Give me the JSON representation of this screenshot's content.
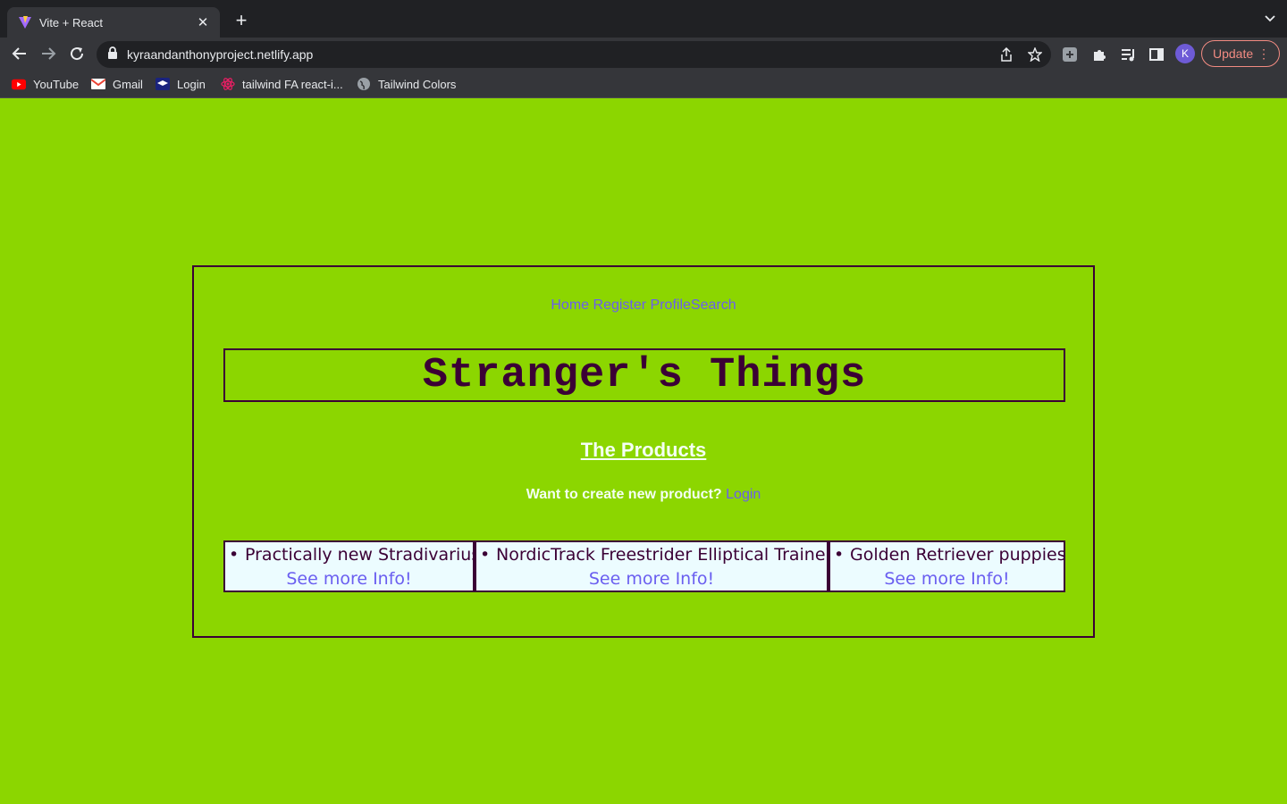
{
  "browser": {
    "tab_title": "Vite + React",
    "url": "kyraandanthonyproject.netlify.app",
    "avatar_letter": "K",
    "update_label": "Update",
    "bookmarks": [
      {
        "label": "YouTube",
        "icon": "youtube-icon"
      },
      {
        "label": "Gmail",
        "icon": "gmail-icon"
      },
      {
        "label": "Login",
        "icon": "graduation-cap-icon"
      },
      {
        "label": "tailwind FA react-i...",
        "icon": "react-icon"
      },
      {
        "label": "Tailwind Colors",
        "icon": "globe-icon"
      }
    ]
  },
  "site": {
    "nav": {
      "home": "Home",
      "register": "Register",
      "profile": "Profile",
      "search": "Search"
    },
    "title": "Stranger's Things",
    "products_heading": "The Products",
    "create_prompt": "Want to create new product?",
    "create_login": "Login",
    "products": [
      {
        "name": "Practically new Stradivarius",
        "link": "See more Info!"
      },
      {
        "name": "NordicTrack Freestrider Elliptical Trainer",
        "link": "See more Info!"
      },
      {
        "name": "Golden Retriever puppies",
        "link": "See more Info!"
      }
    ]
  },
  "colors": {
    "background": "#8cd600",
    "border": "#3b0035",
    "link": "#6a5ef0",
    "product_bg": "#ecfcff"
  }
}
